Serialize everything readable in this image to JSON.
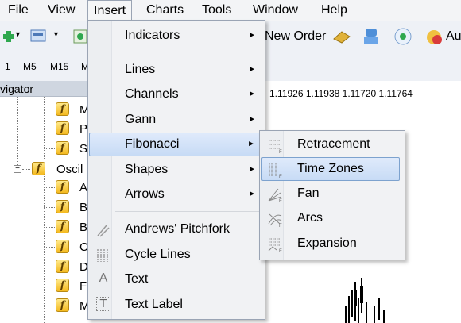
{
  "menubar": {
    "items": [
      "File",
      "View",
      "Insert",
      "Charts",
      "Tools",
      "Window",
      "Help"
    ]
  },
  "toolbar": {
    "new_order_label": "New Order",
    "auto_label": "Au"
  },
  "timeframes": [
    "1",
    "M5",
    "M15",
    "M"
  ],
  "navigator": {
    "title": "vigator",
    "items": [
      "M",
      "P",
      "S",
      "Oscil",
      "A",
      "B",
      "B",
      "C",
      "D",
      "F",
      "M"
    ]
  },
  "chart": {
    "price_text": "1.11926 1.11938 1.11720 1.11764"
  },
  "insert_menu": {
    "items": [
      {
        "label": "Indicators",
        "submenu": true
      },
      {
        "label": "Lines",
        "submenu": true
      },
      {
        "label": "Channels",
        "submenu": true
      },
      {
        "label": "Gann",
        "submenu": true
      },
      {
        "label": "Fibonacci",
        "submenu": true,
        "highlighted": true
      },
      {
        "label": "Shapes",
        "submenu": true
      },
      {
        "label": "Arrows",
        "submenu": true
      },
      {
        "label": "Andrews' Pitchfork",
        "icon": "pitchfork-icon"
      },
      {
        "label": "Cycle Lines",
        "icon": "cycle-lines-icon"
      },
      {
        "label": "Text",
        "icon": "text-icon"
      },
      {
        "label": "Text Label",
        "icon": "text-label-icon"
      }
    ],
    "arrow_glyph": "►",
    "text_icon_glyph": "A",
    "text_label_icon_glyph": "T"
  },
  "fibonacci_submenu": {
    "items": [
      {
        "label": "Retracement",
        "icon": "fib-retracement-icon"
      },
      {
        "label": "Time Zones",
        "icon": "fib-time-zones-icon",
        "highlighted": true
      },
      {
        "label": "Fan",
        "icon": "fib-fan-icon"
      },
      {
        "label": "Arcs",
        "icon": "fib-arcs-icon"
      },
      {
        "label": "Expansion",
        "icon": "fib-expansion-icon"
      }
    ]
  },
  "colors": {
    "menu_bg": "#f1f2f4",
    "highlight": "#c7dbf5",
    "highlight_border": "#7da2ce"
  }
}
